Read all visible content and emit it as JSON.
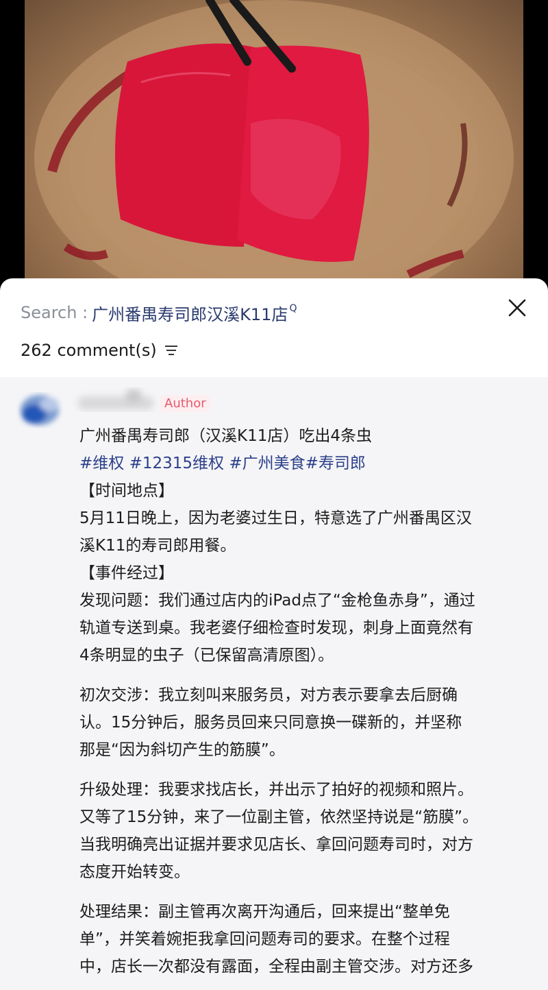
{
  "search": {
    "prefix": "Search :",
    "query": "广州番禺寿司郎汉溪K11店",
    "mark": "Q"
  },
  "comments": {
    "count_label": "262 comment(s)"
  },
  "post": {
    "author_badge": "Author",
    "title": "广州番禺寿司郎（汉溪K11店）吃出4条虫",
    "tags": [
      "#维权",
      "#12315维权",
      "#广州美食",
      "#寿司郎"
    ],
    "section_time": "【时间地点】",
    "time_text_1": "5月11日晚上，因为老婆过生日，特意选了广州番禺区汉",
    "time_text_2": "溪K11的寿司郎用餐。",
    "section_event": "【事件经过】",
    "p1_l1": "发现问题：我们通过店内的iPad点了“金枪鱼赤身”，通过",
    "p1_l2": "轨道专送到桌。我老婆仔细检查时发现，刺身上面竟然有",
    "p1_l3": "4条明显的虫子（已保留高清原图）。",
    "p2_l1": "初次交涉：我立刻叫来服务员，对方表示要拿去后厨确",
    "p2_l2": "认。15分钟后，服务员回来只同意换一碟新的，并坚称",
    "p2_l3": "那是“因为斜切产生的筋膜”。",
    "p3_l1": "升级处理：我要求找店长，并出示了拍好的视频和照片。",
    "p3_l2": "又等了15分钟，来了一位副主管，依然坚持说是“筋膜”。",
    "p3_l3": "当我明确亮出证据并要求见店长、拿回问题寿司时，对方",
    "p3_l4": "态度开始转变。",
    "p4_l1": "处理结果：副主管再次离开沟通后，回来提出“整单免",
    "p4_l2": "单”，并笑着婉拒我拿回问题寿司的要求。在整个过程",
    "p4_l3": "中，店长一次都没有露面，全程由副主管交涉。对方还多"
  },
  "colors": {
    "tag_blue": "#2b3f8a",
    "badge_pink": "#e35a6e",
    "thread_bg": "#f5f5f7"
  }
}
